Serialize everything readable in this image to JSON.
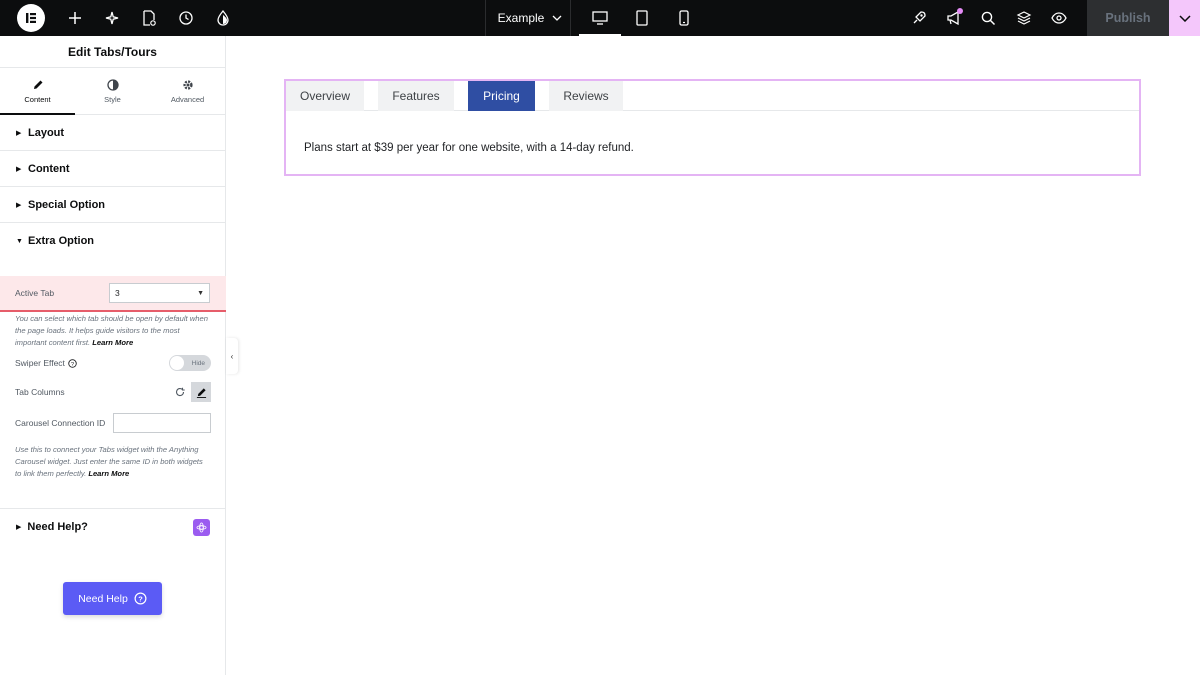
{
  "topbar": {
    "page_name": "Example",
    "publish_label": "Publish",
    "icons": [
      "elementor-logo-icon",
      "add-icon",
      "ai-sparkle-icon",
      "page-settings-icon",
      "history-icon",
      "site-settings-icon",
      "rocket-icon",
      "announcements-icon",
      "search-icon",
      "structure-icon",
      "preview-eye-icon",
      "chevron-down-icon"
    ]
  },
  "panel": {
    "title": "Edit Tabs/Tours",
    "tabs": [
      {
        "label": "Content",
        "icon": "pencil-icon"
      },
      {
        "label": "Style",
        "icon": "contrast-icon"
      },
      {
        "label": "Advanced",
        "icon": "gear-icon"
      }
    ],
    "sections": {
      "layout": "Layout",
      "content": "Content",
      "special": "Special Option",
      "extra": "Extra Option",
      "need_help": "Need Help?"
    },
    "active_tab": {
      "label": "Active Tab",
      "value": "3"
    },
    "active_tab_help": "You can select which tab should be open by default when the page loads. It helps guide visitors to the most important content first.",
    "learn_more": "Learn More",
    "swiper": {
      "label": "Swiper Effect",
      "toggle": "Hide"
    },
    "tab_columns_label": "Tab Columns",
    "carousel": {
      "label": "Carousel Connection ID",
      "value": ""
    },
    "carousel_help": "Use this to connect your Tabs widget with the Anything Carousel widget. Just enter the same ID in both widgets to link them perfectly.",
    "learn_more_2": "Learn More",
    "need_help_button": "Need Help"
  },
  "widget": {
    "tabs": [
      "Overview",
      "Features",
      "Pricing",
      "Reviews"
    ],
    "active_index": 2,
    "content": "Plans start at $39 per year for one website, with a 14-day refund."
  },
  "colors": {
    "accent_tab": "#2f4ea3",
    "highlight_row": "#fde8ea",
    "widget_border": "#e4b4f4",
    "help_button": "#5b5bf5"
  }
}
